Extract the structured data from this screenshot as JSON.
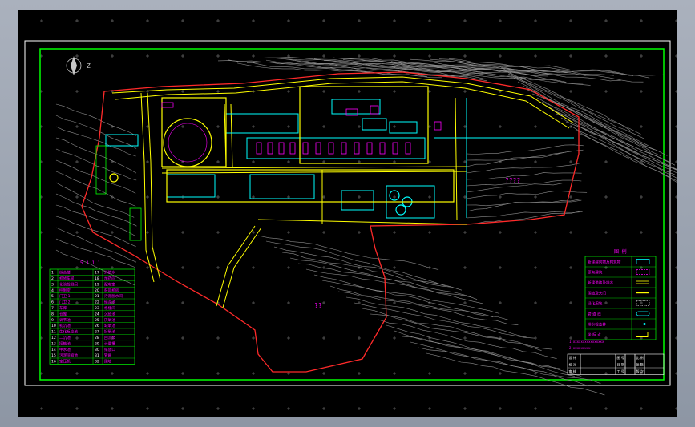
{
  "app": {
    "name": "CAD drawing viewer"
  },
  "colors": {
    "background": "#000000",
    "border_outer": "#ffffff",
    "border_inner": "#00ff00",
    "site_boundary": "#ff2a2a",
    "road": "#ffff00",
    "building": "#00ffff",
    "contour": "#8c8c8c",
    "label": "#ff00ff"
  },
  "drawing": {
    "north_arrow": "N",
    "north_label": "Z",
    "table_title": "5.1  1.1",
    "legend_title": "图  例",
    "site_label_1": "????",
    "site_label_2": "??",
    "title_block_note": "1.xxxxxxxxxxxxxxxx",
    "title_block_note2": "2.xxxxxxxxx"
  },
  "schedule": {
    "rows": [
      {
        "no": "1",
        "name": "综合楼",
        "code": "17",
        "item": "消防水"
      },
      {
        "no": "2",
        "name": "机修车间",
        "code": "18",
        "item": "加药间"
      },
      {
        "no": "3",
        "name": "化验检测间",
        "code": "19",
        "item": "配电室"
      },
      {
        "no": "4",
        "name": "控制室",
        "code": "20",
        "item": "鼓风机房"
      },
      {
        "no": "5",
        "name": "门卫 1",
        "code": "21",
        "item": "污泥脱水间"
      },
      {
        "no": "6",
        "name": "门卫 2",
        "code": "22",
        "item": "储泥池"
      },
      {
        "no": "7",
        "name": "车库",
        "code": "23",
        "item": "格栅间"
      },
      {
        "no": "8",
        "name": "仓库",
        "code": "24",
        "item": "沉砂池"
      },
      {
        "no": "9",
        "name": "调节池",
        "code": "25",
        "item": "厌氧池"
      },
      {
        "no": "10",
        "name": "初沉池",
        "code": "26",
        "item": "缺氧池"
      },
      {
        "no": "11",
        "name": "生化反应池",
        "code": "27",
        "item": "好氧池"
      },
      {
        "no": "12",
        "name": "二沉池",
        "code": "28",
        "item": "回流泵"
      },
      {
        "no": "13",
        "name": "接触池",
        "code": "29",
        "item": "计量槽"
      },
      {
        "no": "14",
        "name": "中水池",
        "code": "30",
        "item": "排放口"
      },
      {
        "no": "15",
        "name": "污泥浓缩池",
        "code": "31",
        "item": "管廊"
      },
      {
        "no": "16",
        "name": "空压机",
        "code": "32",
        "item": "围墙"
      }
    ]
  },
  "legend": {
    "items": [
      {
        "label": "新建建筑物及构筑物",
        "swatch": "box"
      },
      {
        "label": "原有建筑",
        "swatch": "dash-box"
      },
      {
        "label": "新建道路及排水",
        "swatch": "double-line"
      },
      {
        "label": "围墙及大门",
        "swatch": "yellow-line"
      },
      {
        "label": "绿化用地",
        "swatch": "dash-rect"
      },
      {
        "label": "管 道 线",
        "swatch": "pipe"
      },
      {
        "label": "排水检查井",
        "swatch": "dot-line"
      },
      {
        "label": "坐 标 点",
        "swatch": "corner"
      }
    ]
  },
  "title_block": {
    "rows": [
      [
        "设 计",
        "",
        "图 号",
        "",
        "比 例",
        ""
      ],
      [
        "校 对",
        "",
        "日 期",
        "",
        "张 数",
        ""
      ],
      [
        "审 核",
        "",
        "工 号",
        "",
        "版 次",
        ""
      ]
    ]
  }
}
